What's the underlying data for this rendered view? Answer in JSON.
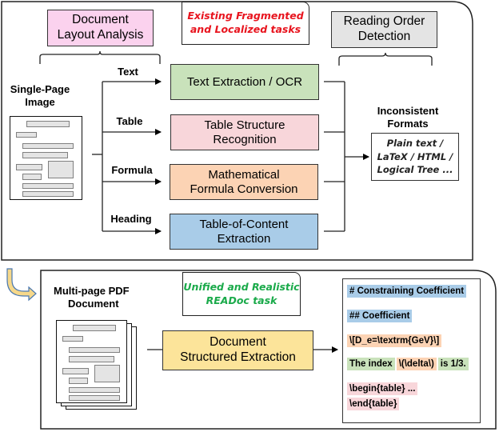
{
  "top_panel": {
    "callout_line1": "Existing Fragmented",
    "callout_line2": "and Localized tasks",
    "layout_analysis_line1": "Document",
    "layout_analysis_line2": "Layout Analysis",
    "reading_order_line1": "Reading Order",
    "reading_order_line2": "Detection",
    "input_label_line1": "Single-Page",
    "input_label_line2": "Image",
    "branches": [
      {
        "label": "Text",
        "task_line1": "Text Extraction / OCR",
        "task_line2": "",
        "color": "#c9e2bb"
      },
      {
        "label": "Table",
        "task_line1": "Table Structure",
        "task_line2": "Recognition",
        "color": "#f8d6da"
      },
      {
        "label": "Formula",
        "task_line1": "Mathematical",
        "task_line2": "Formula Conversion",
        "color": "#fcd3b4"
      },
      {
        "label": "Heading",
        "task_line1": "Table-of-Content",
        "task_line2": "Extraction",
        "color": "#a9cce8"
      }
    ],
    "output_label_line1": "Inconsistent",
    "output_label_line2": "Formats",
    "formats_line1": "Plain text /",
    "formats_line2": "LaTeX / HTML /",
    "formats_line3": "Logical Tree ..."
  },
  "bottom_panel": {
    "callout_line1": "Unified and Realistic",
    "callout_line2": "READoc task",
    "input_label_line1": "Multi-page PDF",
    "input_label_line2": "Document",
    "task_line1": "Document",
    "task_line2": "Structured Extraction",
    "task_color": "#fce49a",
    "output_lines": {
      "h1": "# Constraining Coefficient",
      "h2": "## Coefficient",
      "formula": "\\[D_e=\\textrm{GeV}\\]",
      "text_a": "The index",
      "text_inline_formula": "\\(\\delta\\)",
      "text_b": "is 1/3.",
      "table_1": "\\begin{table} ...",
      "table_2": "\\end{table}"
    }
  },
  "colors": {
    "callout_top": "#e8141e",
    "callout_bottom": "#1aaa4a",
    "layout_analysis_bg": "#fbd2ee",
    "reading_order_bg": "#e4e4e4",
    "heading_hl": "#a9cce8",
    "formula_hl": "#fcd3b4",
    "text_hl": "#c9e2bb",
    "table_hl": "#f8d6da",
    "transition_arrow": "#f6d88a"
  }
}
